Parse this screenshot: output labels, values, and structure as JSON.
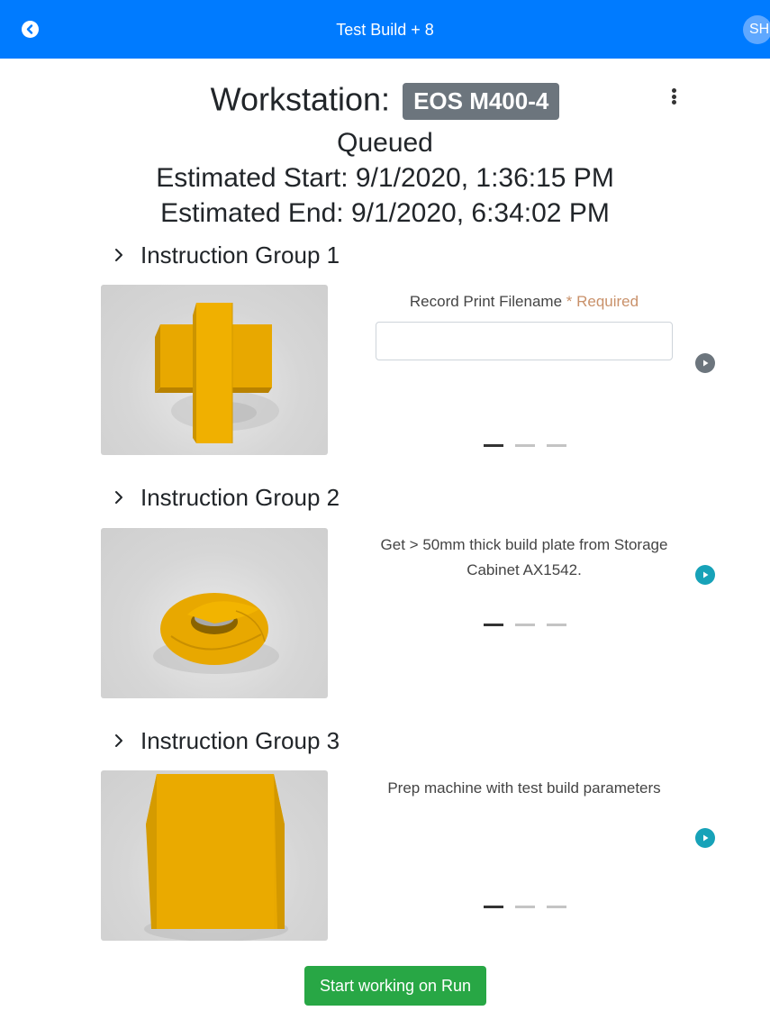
{
  "navbar": {
    "title": "Test Build + 8",
    "user_initials": "SH"
  },
  "workstation": {
    "label": "Workstation:",
    "name": "EOS M400-4"
  },
  "status": {
    "state": "Queued",
    "estimated_start": "Estimated Start: 9/1/2020, 1:36:15 PM",
    "estimated_end": "Estimated End: 9/1/2020, 6:34:02 PM"
  },
  "groups": [
    {
      "title": "Instruction Group 1",
      "instruction_text": "Record Print Filename",
      "required_label": "* Required",
      "input_value": "",
      "carousel_slides": 3,
      "active_slide": 1
    },
    {
      "title": "Instruction Group 2",
      "instruction_text": "Get > 50mm thick build plate from Storage Cabinet AX1542.",
      "carousel_slides": 3,
      "active_slide": 1
    },
    {
      "title": "Instruction Group 3",
      "instruction_text": "Prep machine with test build parameters",
      "carousel_slides": 3,
      "active_slide": 1
    }
  ],
  "actions": {
    "start_label": "Start working on Run"
  },
  "colors": {
    "navbar": "#007bff",
    "badge": "#6c757d",
    "required": "#c9916a",
    "play_disabled": "#6c757d",
    "play_active": "#17a2b8",
    "start_button": "#28a745",
    "model_fill": "#e8a800"
  },
  "icons": {
    "back": "chevron-left-circle-icon",
    "menu": "kebab-menu-icon",
    "expand": "chevron-right-icon",
    "next": "play-circle-icon"
  }
}
